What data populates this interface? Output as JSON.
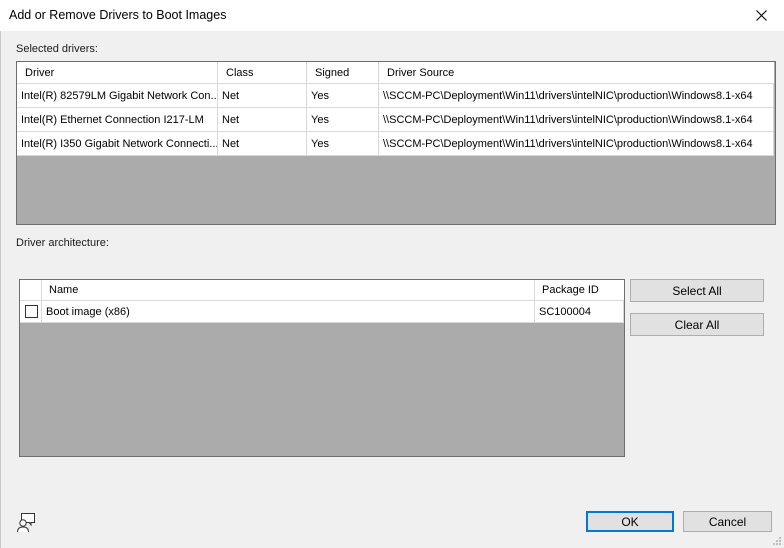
{
  "window": {
    "title": "Add or Remove Drivers to Boot Images"
  },
  "selected_drivers": {
    "label": "Selected drivers:",
    "columns": [
      "Driver",
      "Class",
      "Signed",
      "Driver Source"
    ],
    "rows": [
      [
        "Intel(R) 82579LM Gigabit Network Con...",
        "Net",
        "Yes",
        "\\\\SCCM-PC\\Deployment\\Win11\\drivers\\intelNIC\\production\\Windows8.1-x64"
      ],
      [
        "Intel(R) Ethernet Connection I217-LM",
        "Net",
        "Yes",
        "\\\\SCCM-PC\\Deployment\\Win11\\drivers\\intelNIC\\production\\Windows8.1-x64"
      ],
      [
        "Intel(R) I350 Gigabit Network Connecti...",
        "Net",
        "Yes",
        "\\\\SCCM-PC\\Deployment\\Win11\\drivers\\intelNIC\\production\\Windows8.1-x64"
      ]
    ]
  },
  "driver_architecture": {
    "label": "Driver architecture:",
    "columns": [
      "Name",
      "Package ID"
    ],
    "rows": [
      {
        "checked": false,
        "name": "Boot image (x86)",
        "package_id": "SC100004"
      }
    ]
  },
  "buttons": {
    "select_all": "Select All",
    "clear_all": "Clear All",
    "ok": "OK",
    "cancel": "Cancel"
  },
  "icons": {
    "close": "close-icon",
    "help": "user-help-icon"
  }
}
